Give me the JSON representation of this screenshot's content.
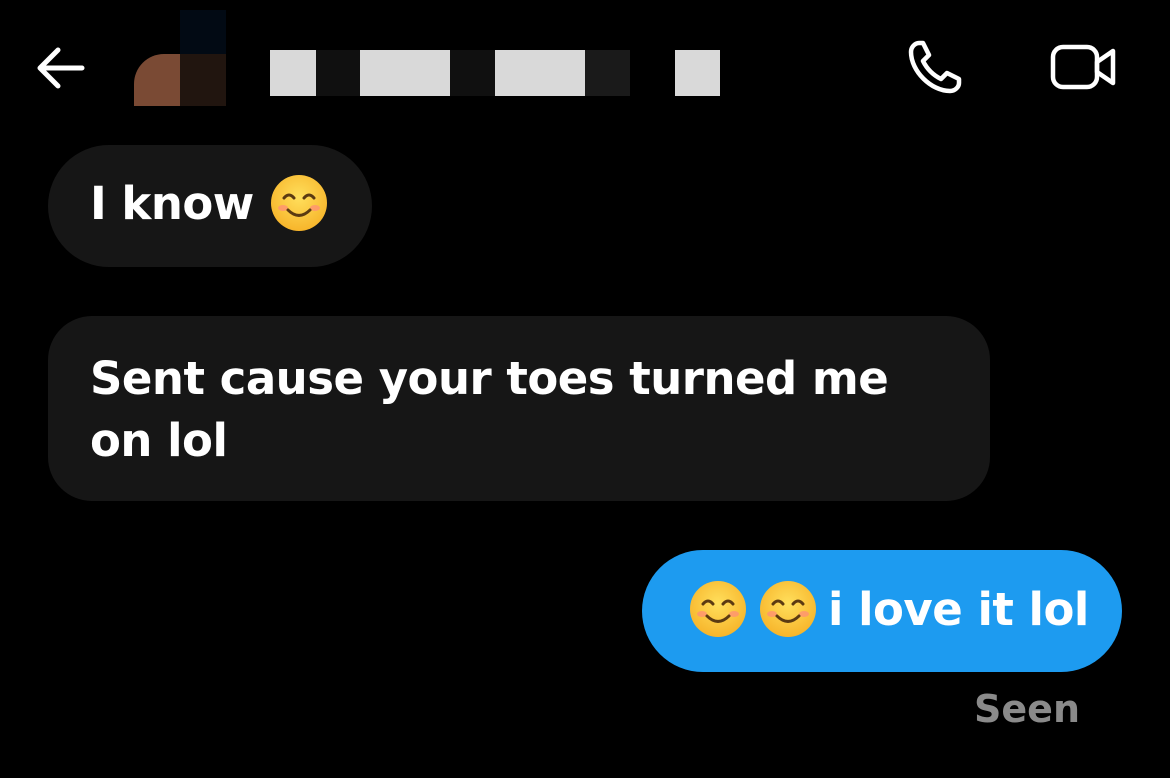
{
  "header": {
    "back_icon": "arrow-left-icon",
    "contact_name": "",
    "call_icon": "phone-icon",
    "video_icon": "video-camera-icon"
  },
  "messages": [
    {
      "direction": "incoming",
      "text": "I know",
      "emoji": [
        "smiling-face-with-smiling-eyes"
      ]
    },
    {
      "direction": "incoming",
      "text": "Sent cause your toes turned me on lol"
    },
    {
      "direction": "outgoing",
      "emoji": [
        "smiling-face-with-smiling-eyes",
        "smiling-face-with-smiling-eyes"
      ],
      "text": "i love it lol"
    }
  ],
  "status": {
    "seen": "Seen"
  },
  "colors": {
    "background": "#000000",
    "incoming_bubble": "#161616",
    "outgoing_bubble": "#1d9bf0",
    "status_text": "#8a8a8a"
  }
}
